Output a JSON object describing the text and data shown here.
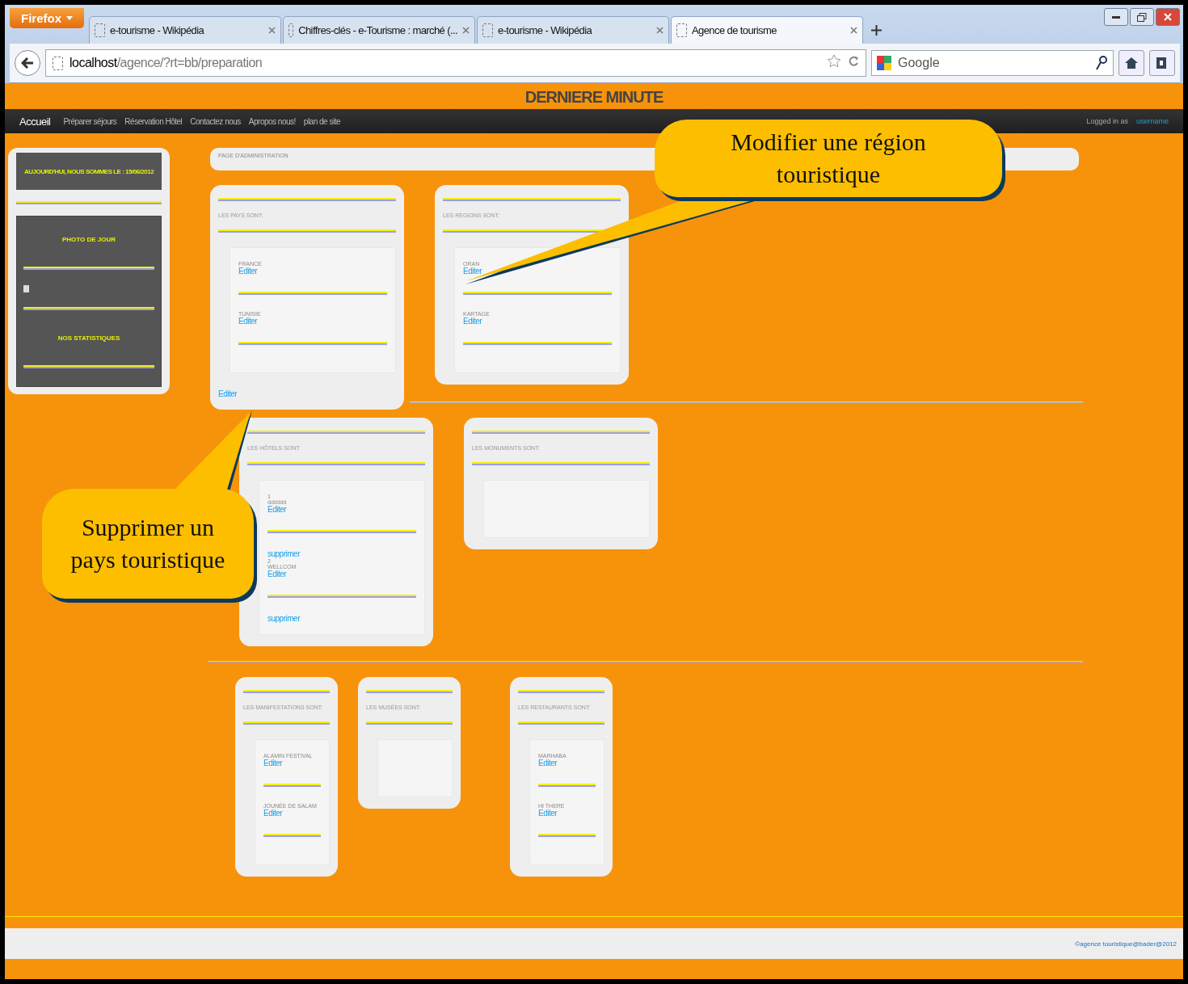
{
  "browser": {
    "menu_button": "Firefox",
    "tabs": [
      {
        "label": "e-tourisme - Wikipédia",
        "selected": false
      },
      {
        "label": "Chiffres-clés - e-Tourisme : marché (...",
        "selected": false
      },
      {
        "label": "e-tourisme - Wikipédia",
        "selected": false
      },
      {
        "label": "Agence de tourisme",
        "selected": true
      }
    ],
    "url_host": "localhost",
    "url_path": "/agence/?rt=bb/preparation",
    "search_placeholder": "Google"
  },
  "site": {
    "banner": "DERNIERE MINUTE",
    "nav": [
      {
        "label": "Accueil",
        "selected": true
      },
      {
        "label": "Préparer séjours",
        "selected": false
      },
      {
        "label": "Réservation Hôtel",
        "selected": false
      },
      {
        "label": "Contactez nous",
        "selected": false
      },
      {
        "label": "Apropos nous!",
        "selected": false
      },
      {
        "label": "plan de site",
        "selected": false
      }
    ],
    "logged_in": "Logged in as",
    "username": "username"
  },
  "sidebar": {
    "date": "AUJOURD'HUI, NOUS SOMMES LE : 15/06/2012",
    "photo_title": "PHOTO DE JOUR",
    "stats_title": "NOS STATISTIQUES"
  },
  "admin_title": "PAGE D'ADMINISTRATION",
  "card_rows": [
    [
      {
        "title": "LES PAYS SONT:",
        "items": [
          {
            "name": "FRANCE",
            "edit": "Editer"
          },
          {
            "name": "TUNISIE",
            "edit": "Editer"
          }
        ],
        "footer_link": "Editer"
      },
      {
        "title": "LES REGIONS SONT:",
        "items": [
          {
            "name": "ORAN",
            "edit": "Editer"
          },
          {
            "name": "KARTAGE",
            "edit": "Editer"
          }
        ]
      }
    ],
    [
      {
        "title": "LES HÔTELS SONT:",
        "items": [
          {
            "number": "1",
            "name": "dddddd",
            "edit": "Editer",
            "delete": "supprimer"
          },
          {
            "number": "2",
            "name": "WELLCOM",
            "edit": "Editer",
            "delete": "supprimer"
          }
        ]
      },
      {
        "title": "LES MONUMENTS SONT:"
      }
    ],
    [
      {
        "title": "LES MANIFESTATIONS SONT:",
        "items": [
          {
            "name": "ALAMIN FESTIVAL",
            "edit": "Editer"
          },
          {
            "name": "JOUNÉE DE SALAM",
            "edit": "Editer"
          }
        ]
      },
      {
        "title": "LES MUSÉES SONT:"
      },
      {
        "title": "LES RESTAURANTS SONT:",
        "items": [
          {
            "name": "MARHABA",
            "edit": "Editer"
          },
          {
            "name": "HI THERE",
            "edit": "Editer"
          }
        ]
      }
    ]
  ],
  "footer": "©agence touristique@bader@2012",
  "callouts": [
    "Modifier une région touristique",
    "Supprimer un pays touristique"
  ]
}
